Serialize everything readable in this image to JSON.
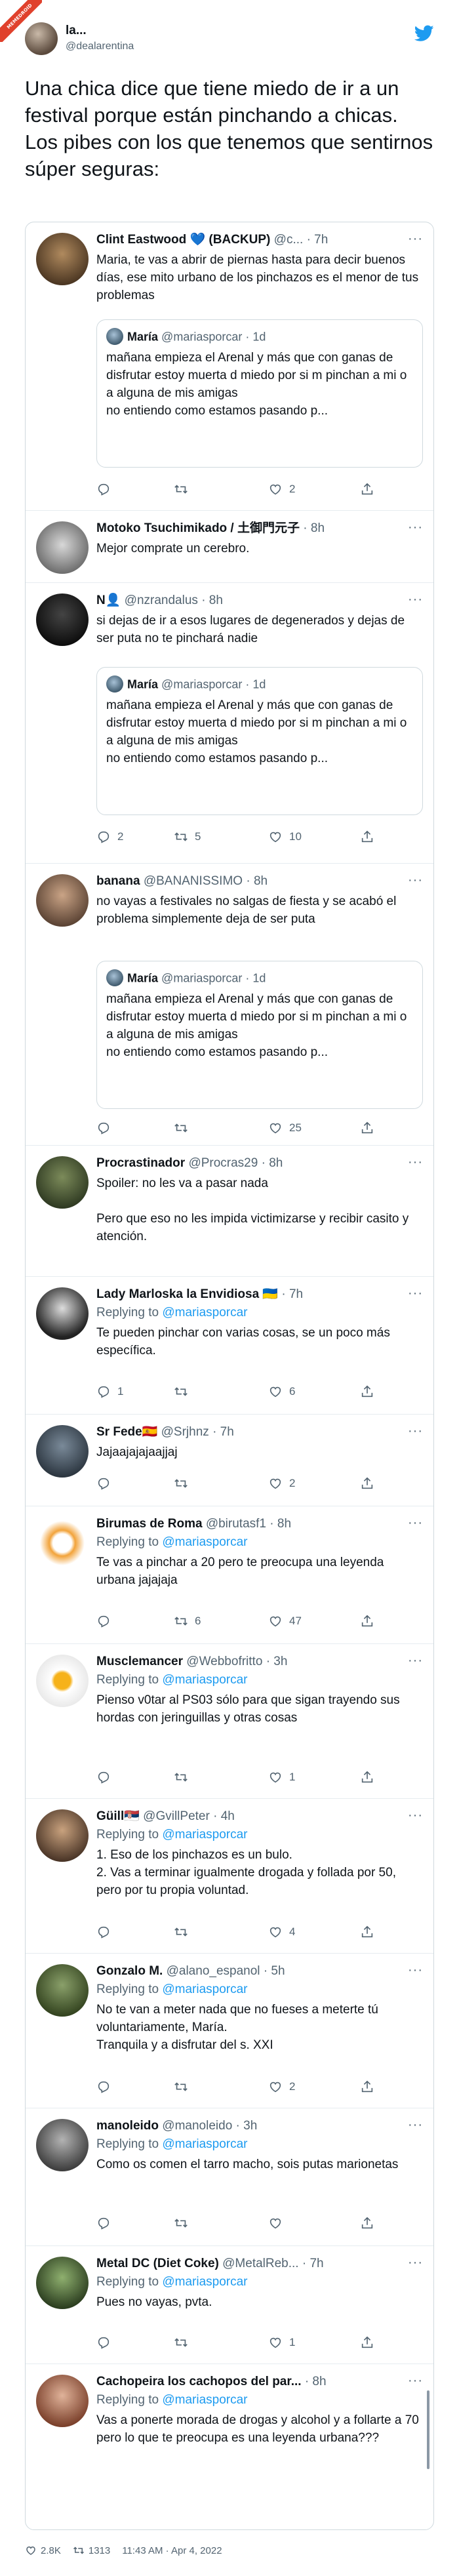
{
  "badge": "MEMEDROID",
  "header": {
    "name": "la...",
    "handle": "@dealarentina"
  },
  "main_text": "Una chica dice que tiene miedo de ir a un festival porque están pinchando a chicas. Los pibes con los que tenemos que sentirnos súper seguras:",
  "quoted_tweet": {
    "name": "María",
    "handle": "@mariasporcar",
    "time": "· 1d",
    "text": "mañana empieza el Arenal y más que con ganas de disfrutar estoy muerta d miedo por si m pinchan a mi o a alguna de mis amigas\nno entiendo como estamos pasando p..."
  },
  "replying_prefix": "Replying to",
  "tweets": [
    {
      "name": "Clint Eastwood 💙 (BACKUP)",
      "handle": "@c...",
      "time": "· 7h",
      "text": "Maria, te vas a abrir de piernas hasta para decir buenos días, ese mito urbano de los pinchazos es el menor de tus problemas",
      "counts": {
        "reply": "",
        "retweet": "",
        "like": "2",
        "share": ""
      }
    },
    {
      "name": "Motoko Tsuchimikado / 土御門元子",
      "handle": "",
      "time": "· 8h",
      "text": "Mejor comprate un cerebro."
    },
    {
      "name": "N👤",
      "handle": "@nzrandalus",
      "time": "· 8h",
      "text": "si dejas de ir a esos lugares de degenerados y dejas de ser puta no te pinchará nadie",
      "counts": {
        "reply": "2",
        "retweet": "5",
        "like": "10",
        "share": ""
      }
    },
    {
      "name": "banana",
      "handle": "@BANANISSIMO",
      "time": "· 8h",
      "text": "no vayas a festivales no salgas de fiesta y se acabó el problema simplemente deja de ser puta",
      "counts": {
        "reply": "",
        "retweet": "",
        "like": "25",
        "share": ""
      }
    },
    {
      "name": "Procrastinador",
      "handle": "@Procras29",
      "time": "· 8h",
      "text": "Spoiler: no les va a pasar nada\n\nPero que eso no les impida victimizarse y recibir casito y atención."
    },
    {
      "name": "Lady Marloska la Envidiosa 🇺🇦",
      "handle": "",
      "time": "· 7h",
      "reply_to": "@mariasporcar",
      "text": "Te pueden pinchar con varias cosas, se un poco más específica.",
      "counts": {
        "reply": "1",
        "retweet": "",
        "like": "6",
        "share": ""
      }
    },
    {
      "name": "Sr Fede🇪🇸",
      "handle": "@Srjhnz",
      "time": "· 7h",
      "text": "Jajaajajajaajjaj",
      "counts": {
        "reply": "",
        "retweet": "",
        "like": "2",
        "share": ""
      }
    },
    {
      "name": "Birumas de Roma",
      "handle": "@birutasf1",
      "time": "· 8h",
      "reply_to": "@mariasporcar",
      "text": "Te vas a pinchar a 20 pero te preocupa una leyenda urbana jajajaja",
      "counts": {
        "reply": "",
        "retweet": "6",
        "like": "47",
        "share": ""
      }
    },
    {
      "name": "Musclemancer",
      "handle": "@Webbofritto",
      "time": "· 3h",
      "reply_to": "@mariasporcar",
      "text": "Pienso v0tar al PS03 sólo para que sigan trayendo sus hordas con jeringuillas y otras cosas",
      "counts": {
        "reply": "",
        "retweet": "",
        "like": "1",
        "share": ""
      }
    },
    {
      "name": "Güill🇷🇸",
      "handle": "@GvillPeter",
      "time": "· 4h",
      "reply_to": "@mariasporcar",
      "text": "1. Eso de los pinchazos es un bulo.\n2. Vas a terminar igualmente drogada y follada por 50, pero por tu propia voluntad.",
      "counts": {
        "reply": "",
        "retweet": "",
        "like": "4",
        "share": ""
      }
    },
    {
      "name": "Gonzalo M.",
      "handle": "@alano_espanol",
      "time": "· 5h",
      "reply_to": "@mariasporcar",
      "text": "No te van a meter nada que no fueses a meterte tú voluntariamente, María.\nTranquila y a disfrutar del s. XXI",
      "counts": {
        "reply": "",
        "retweet": "",
        "like": "2",
        "share": ""
      }
    },
    {
      "name": "manoleido",
      "handle": "@manoleido",
      "time": "· 3h",
      "reply_to": "@mariasporcar",
      "text": "Como os comen el tarro macho, sois putas marionetas",
      "counts": {
        "reply": "",
        "retweet": "",
        "like": "",
        "share": ""
      }
    },
    {
      "name": "Metal DC (Diet Coke)",
      "handle": "@MetalReb...",
      "time": "· 7h",
      "reply_to": "@mariasporcar",
      "text": "Pues no vayas, pvta.",
      "counts": {
        "reply": "",
        "retweet": "",
        "like": "1",
        "share": ""
      }
    },
    {
      "name": "Cachopeira los cachopos del par...",
      "handle": "",
      "time": "· 8h",
      "reply_to": "@mariasporcar",
      "text": "Vas a ponerte morada de drogas y alcohol y a follarte a 70 pero lo que te preocupa es una leyenda urbana???"
    }
  ],
  "footer": {
    "likes": "2.8K",
    "retweets": "1313",
    "timestamp": "11:43 AM · Apr 4, 2022"
  },
  "colors": {
    "accent": "#1d9bf0",
    "secondary_text": "#536471",
    "border": "#cfd9de",
    "badge": "#e0412c"
  },
  "icons": [
    "twitter-bird-icon",
    "reply-icon",
    "retweet-icon",
    "like-icon",
    "share-icon",
    "more-icon"
  ]
}
